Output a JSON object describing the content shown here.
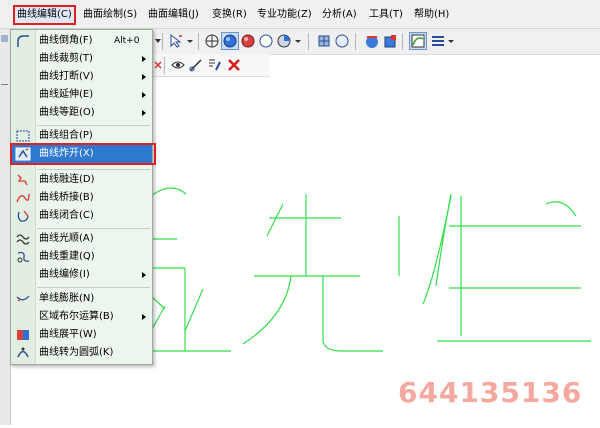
{
  "menubar": {
    "items": [
      {
        "label": "曲线编辑(C)",
        "active": true
      },
      {
        "label": "曲面绘制(S)"
      },
      {
        "label": "曲面编辑(J)"
      },
      {
        "label": "变换(R)"
      },
      {
        "label": "专业功能(Z)"
      },
      {
        "label": "分析(A)"
      },
      {
        "label": "工具(T)"
      },
      {
        "label": "帮助(H)"
      }
    ]
  },
  "curve_menu": {
    "items": [
      {
        "label": "曲线倒角(F)",
        "shortcut": "Alt+0",
        "submenu": false,
        "icon": "curve-fillet-icon"
      },
      {
        "label": "曲线裁剪(T)",
        "submenu": true,
        "icon": "none"
      },
      {
        "label": "曲线打断(V)",
        "submenu": true,
        "icon": "none"
      },
      {
        "label": "曲线延伸(E)",
        "submenu": true,
        "icon": "none"
      },
      {
        "label": "曲线等距(O)",
        "submenu": true,
        "icon": "none"
      },
      {
        "label": "曲线组合(P)",
        "submenu": false,
        "icon": "curve-join-icon"
      },
      {
        "label": "曲线炸开(X)",
        "submenu": false,
        "selected": true,
        "icon": "curve-explode-icon"
      },
      {
        "label": "曲线融连(D)",
        "submenu": false,
        "icon": "curve-blend-icon"
      },
      {
        "label": "曲线桥接(B)",
        "submenu": false,
        "icon": "curve-bridge-icon"
      },
      {
        "label": "曲线闭合(C)",
        "submenu": false,
        "icon": "curve-close-icon"
      },
      {
        "label": "曲线光顺(A)",
        "submenu": false,
        "icon": "curve-smooth-icon"
      },
      {
        "label": "曲线重建(Q)",
        "submenu": false,
        "icon": "curve-rebuild-icon"
      },
      {
        "label": "曲线编修(I)",
        "submenu": true,
        "icon": "none"
      },
      {
        "label": "单线膨胀(N)",
        "submenu": false,
        "icon": "curve-inflate-icon"
      },
      {
        "label": "区域布尔运算(B)",
        "submenu": true,
        "icon": "none"
      },
      {
        "label": "曲线展平(W)",
        "submenu": false,
        "icon": "curve-flatten-icon"
      },
      {
        "label": "曲线转为圆弧(K)",
        "submenu": false,
        "icon": "curve-to-arc-icon"
      }
    ]
  },
  "colors": {
    "highlight": "#e02020",
    "selection": "#2f78d0",
    "curve": "#33e04a",
    "watermark": "#f4a9a0"
  },
  "watermark": {
    "text": "644135136"
  }
}
